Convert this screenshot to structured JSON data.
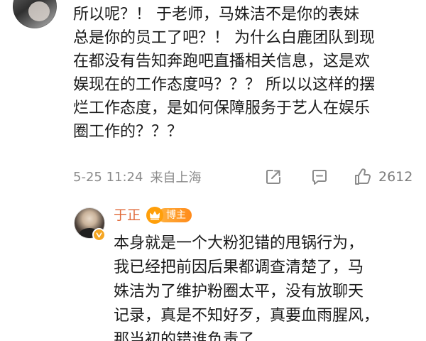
{
  "comment": {
    "lines": [
      "所以呢？！ 于老师，马姝洁不是你的表妹",
      "总是你的员工了吧？！ 为什么白鹿团队到现",
      "在都没有告知奔跑吧直播相关信息，这是欢",
      "娱现在的工作态度吗？？？ 所以以这样的摆",
      "烂工作态度，是如何保障服务于艺人在娱乐",
      "圈工作的？？？"
    ],
    "timestamp": "5-25 11:24",
    "location": "来自上海",
    "likes": "2612",
    "icons": {
      "share": "share-icon",
      "comment": "comment-icon",
      "like": "thumbs-up-icon"
    }
  },
  "reply": {
    "author": "于正",
    "badge_label": "博主",
    "badge_icon": "crown-icon",
    "verified_icon": "verified-v-icon",
    "lines": [
      "本身就是一个大粉犯错的甩锅行为，",
      "我已经把前因后果都调查清楚了，马",
      "姝洁为了维护粉圈太平，没有放聊天",
      "记录，真是不知好歹，真要血雨腥风，",
      "那当初的错谁负责了"
    ]
  },
  "colors": {
    "author_name": "#e06a3a",
    "badge": "#ff9f0a",
    "meta_text": "#8a8a8a",
    "body_text": "#1a1a1a"
  }
}
